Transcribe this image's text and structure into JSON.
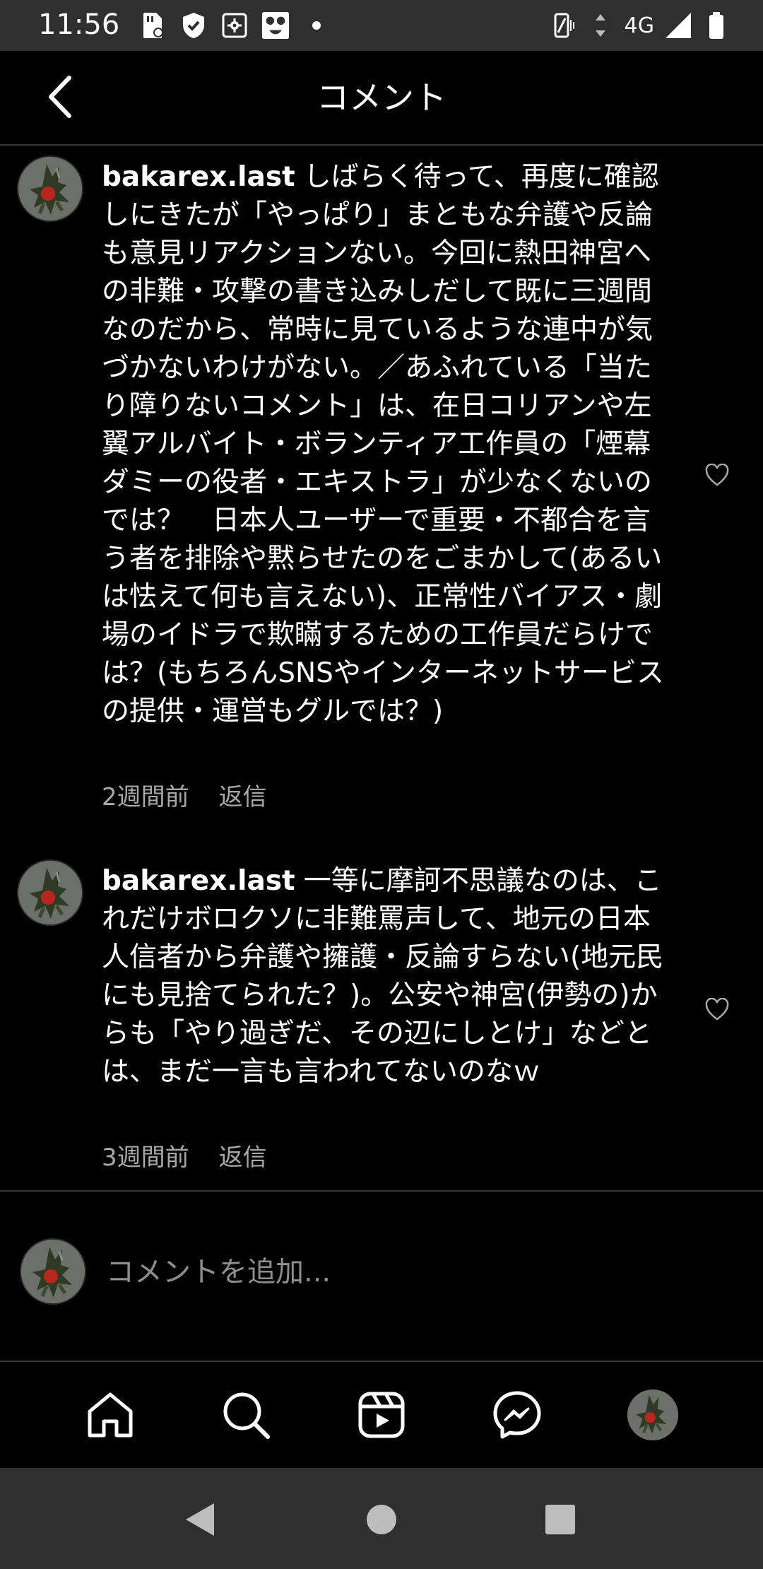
{
  "status_bar": {
    "time": "11:56",
    "network": "4G",
    "left_icons": [
      "sd-card-icon",
      "shield-icon",
      "settings-box-icon",
      "app-face-icon",
      "dot-icon"
    ],
    "right_icons": [
      "vibrate-icon",
      "data-arrows-icon",
      "signal-icon",
      "battery-icon"
    ]
  },
  "header": {
    "title": "コメント",
    "back_icon": "chevron-left-icon"
  },
  "comments": [
    {
      "username": "bakarex.last",
      "text": "しばらく待って、再度に確認しにきたが「やっぱり」まともな弁護や反論も意見リアクションない。今回に熱田神宮への非難・攻撃の書き込みしだして既に三週間なのだから、常時に見ているような連中が気づかないわけがない。／あふれている「当たり障りないコメント」は、在日コリアンや左翼アルバイト・ボランティア工作員の「煙幕ダミーの役者・エキストラ」が少なくないのでは？　日本人ユーザーで重要・不都合を言う者を排除や黙らせたのをごまかして(あるいは怯えて何も言えない)、正常性バイアス・劇場のイドラで欺瞞するための工作員だらけでは？(もちろんSNSやインターネットサービスの提供・運営もグルでは？)",
      "time": "2週間前",
      "reply_label": "返信",
      "like_icon": "heart-outline-icon"
    },
    {
      "username": "bakarex.last",
      "text": "一等に摩訶不思議なのは、これだけボロクソに非難罵声して、地元の日本人信者から弁護や擁護・反論すらない(地元民にも見捨てられた？)。公安や神宮(伊勢の)からも「やり過ぎだ、その辺にしとけ」などとは、まだ一言も言われてないのなｗ",
      "time": "3週間前",
      "reply_label": "返信",
      "like_icon": "heart-outline-icon"
    }
  ],
  "composer": {
    "placeholder": "コメントを追加..."
  },
  "bottom_nav": [
    "home-icon",
    "search-icon",
    "reels-icon",
    "messenger-icon",
    "profile-avatar"
  ],
  "android_nav": [
    "back-triangle-icon",
    "home-circle-icon",
    "recents-square-icon"
  ]
}
